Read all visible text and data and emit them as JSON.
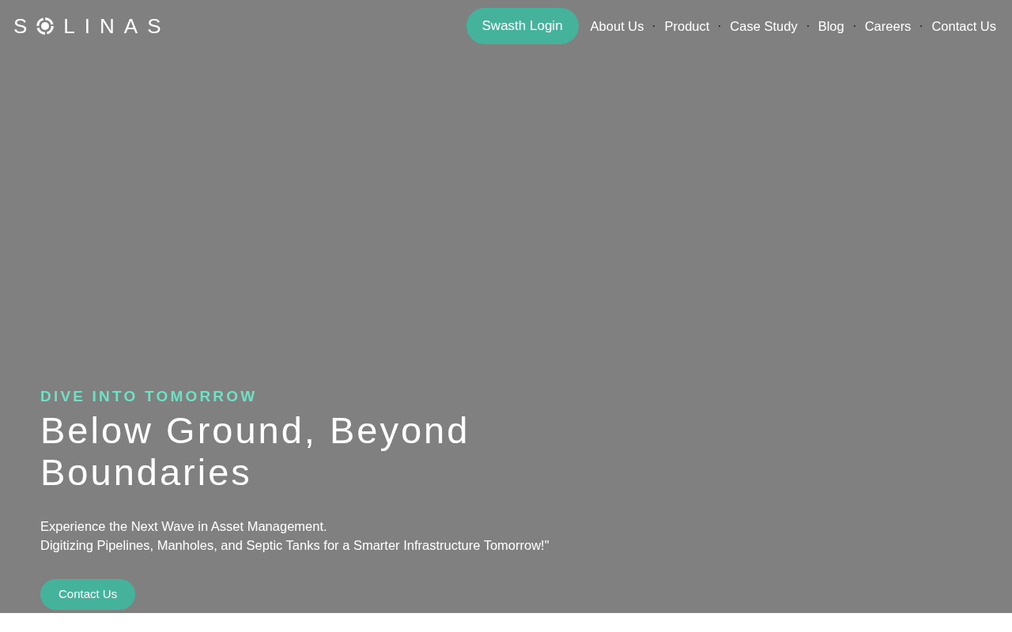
{
  "logo": {
    "lead": "S",
    "rest": "LINAS"
  },
  "nav": {
    "login_button": "Swasth Login",
    "links": [
      {
        "label": "About Us"
      },
      {
        "label": "Product"
      },
      {
        "label": "Case Study"
      },
      {
        "label": "Blog"
      },
      {
        "label": "Careers"
      },
      {
        "label": "Contact Us"
      }
    ]
  },
  "hero": {
    "eyebrow": "DIVE INTO TOMORROW",
    "title": "Below Ground, Beyond Boundaries",
    "lines": [
      "Experience the Next Wave in Asset Management.",
      "Digitizing Pipelines, Manholes, and Septic Tanks for a Smarter Infrastructure Tomorrow!\""
    ],
    "button": "Contact Us"
  }
}
